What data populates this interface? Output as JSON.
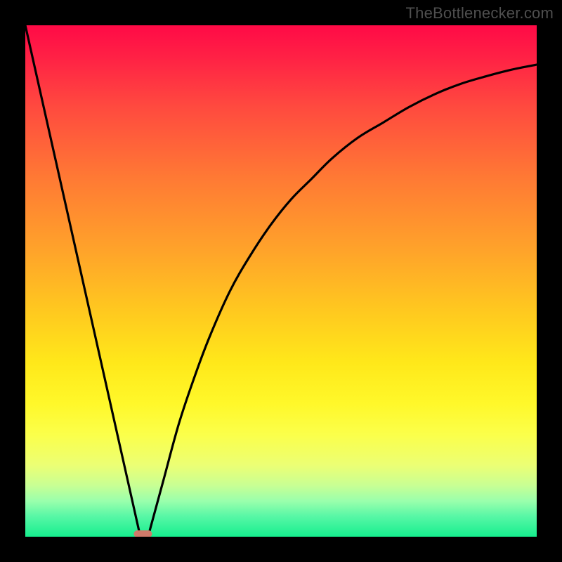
{
  "watermark": "TheBottlenecker.com",
  "chart_data": {
    "type": "line",
    "title": "",
    "xlabel": "",
    "ylabel": "",
    "xlim": [
      0,
      100
    ],
    "ylim": [
      0,
      100
    ],
    "grid": false,
    "legend": false,
    "gradient": {
      "direction": "vertical",
      "stops": [
        {
          "pos": 0,
          "color": "#ff0a46"
        },
        {
          "pos": 100,
          "color": "#16ee8e"
        }
      ]
    },
    "marker": {
      "x": 23,
      "y": 0,
      "color": "#d07a6a",
      "shape": "capsule"
    },
    "series": [
      {
        "name": "left-edge",
        "x": [
          0,
          22.5
        ],
        "y": [
          100,
          0
        ]
      },
      {
        "name": "right-curve",
        "x": [
          24,
          27,
          30,
          33,
          36,
          40,
          44,
          48,
          52,
          56,
          60,
          65,
          70,
          75,
          80,
          85,
          90,
          95,
          100
        ],
        "y": [
          0,
          11,
          22,
          31,
          39,
          48,
          55,
          61,
          66,
          70,
          74,
          78,
          81,
          84,
          86.5,
          88.5,
          90,
          91.3,
          92.3
        ]
      }
    ]
  }
}
